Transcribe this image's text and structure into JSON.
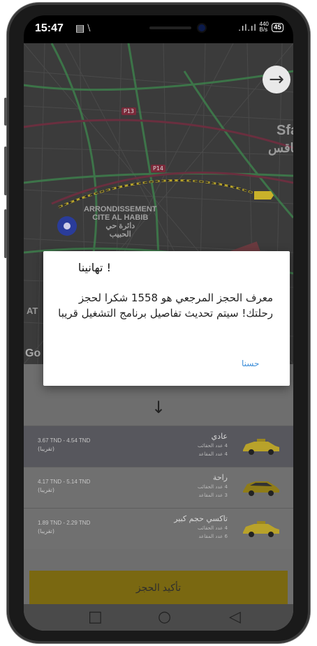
{
  "status_bar": {
    "time": "15:47",
    "left_icons": "▤ ⧵",
    "signal": ".ıl.ıl",
    "net_speed_value": "440",
    "net_speed_unit": "B/s",
    "battery": "45"
  },
  "map": {
    "road_labels": [
      "P13",
      "P14"
    ],
    "area_label_line1": "ARRONDISSEMENT",
    "area_label_line2": "CITE AL HABIB",
    "area_label_ar1": "دائرة حي",
    "area_label_ar2": "الحبيب",
    "city_label": "Sfax",
    "city_label_ar": "صفاقس",
    "google_watermark": "Go",
    "left_partial": "AT"
  },
  "dialog": {
    "title": "! تهانينا",
    "body": "معرف الحجز المرجعي هو 1558 شكرا لحجز رحلتك! سيتم تحديث تفاصيل برنامج التشغيل قريبا",
    "ok_label": "حسنا"
  },
  "sheet": {
    "down_arrow": "↓",
    "options": [
      {
        "price": "3.67 TND - 4.54 TND",
        "approx": "(تقريبا)",
        "name": "عادي",
        "bags": "4 عدد الحقائب",
        "seats": "4 عدد المقاعد",
        "selected": true
      },
      {
        "price": "4.17 TND - 5.14 TND",
        "approx": "(تقريبا)",
        "name": "راحة",
        "bags": "4 عدد الحقائب",
        "seats": "3 عدد المقاعد",
        "selected": false
      },
      {
        "price": "1.89 TND - 2.29 TND",
        "approx": "(تقريبا)",
        "name": "تاكسي حجم كبير",
        "bags": "4 عدد الحقائب",
        "seats": "6 عدد المقاعد",
        "selected": false
      }
    ],
    "confirm_label": "تأكيد الحجز"
  },
  "colors": {
    "accent": "#f5d321",
    "link": "#3f8fd9"
  }
}
